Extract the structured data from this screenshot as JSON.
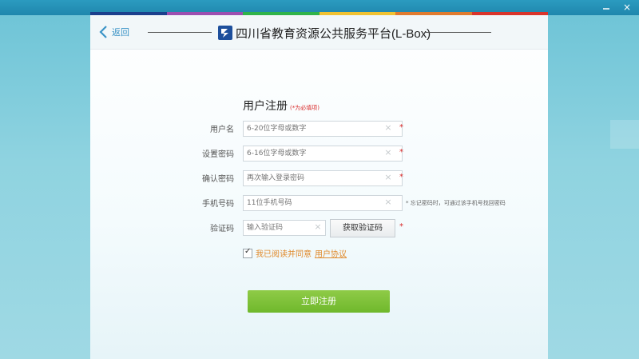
{
  "colors": {
    "strip": [
      "#1c3f8c",
      "#9c4fb0",
      "#2fb34a",
      "#f1c232",
      "#e07b2f",
      "#d9342b"
    ],
    "accent": "#3a93c6",
    "required": "#d92b2b",
    "agree": "#e0892a",
    "submit": "#6fb82c"
  },
  "window": {
    "minimize_icon": "minimize-icon",
    "close_icon": "close-icon",
    "close_label": "×"
  },
  "header": {
    "back_label": "返回",
    "title": "四川省教育资源公共服务平台(L-Box)"
  },
  "form": {
    "title": "用户注册",
    "required_note": "(*为必填项)",
    "username": {
      "label": "用户名",
      "placeholder": "6-20位字母或数字"
    },
    "password": {
      "label": "设置密码",
      "placeholder": "6-16位字母或数字"
    },
    "confirm": {
      "label": "确认密码",
      "placeholder": "再次输入登录密码"
    },
    "phone": {
      "label": "手机号码",
      "placeholder": "11位手机号码",
      "hint": "* 忘记密码时，可通过该手机号找回密码"
    },
    "captcha": {
      "label": "验证码",
      "placeholder": "输入验证码",
      "button": "获取验证码"
    },
    "required_mark": "*",
    "clear_mark": "×",
    "agree": {
      "checked": true,
      "text": "我已阅读并同意",
      "link": "用户协议"
    },
    "submit": "立即注册"
  }
}
